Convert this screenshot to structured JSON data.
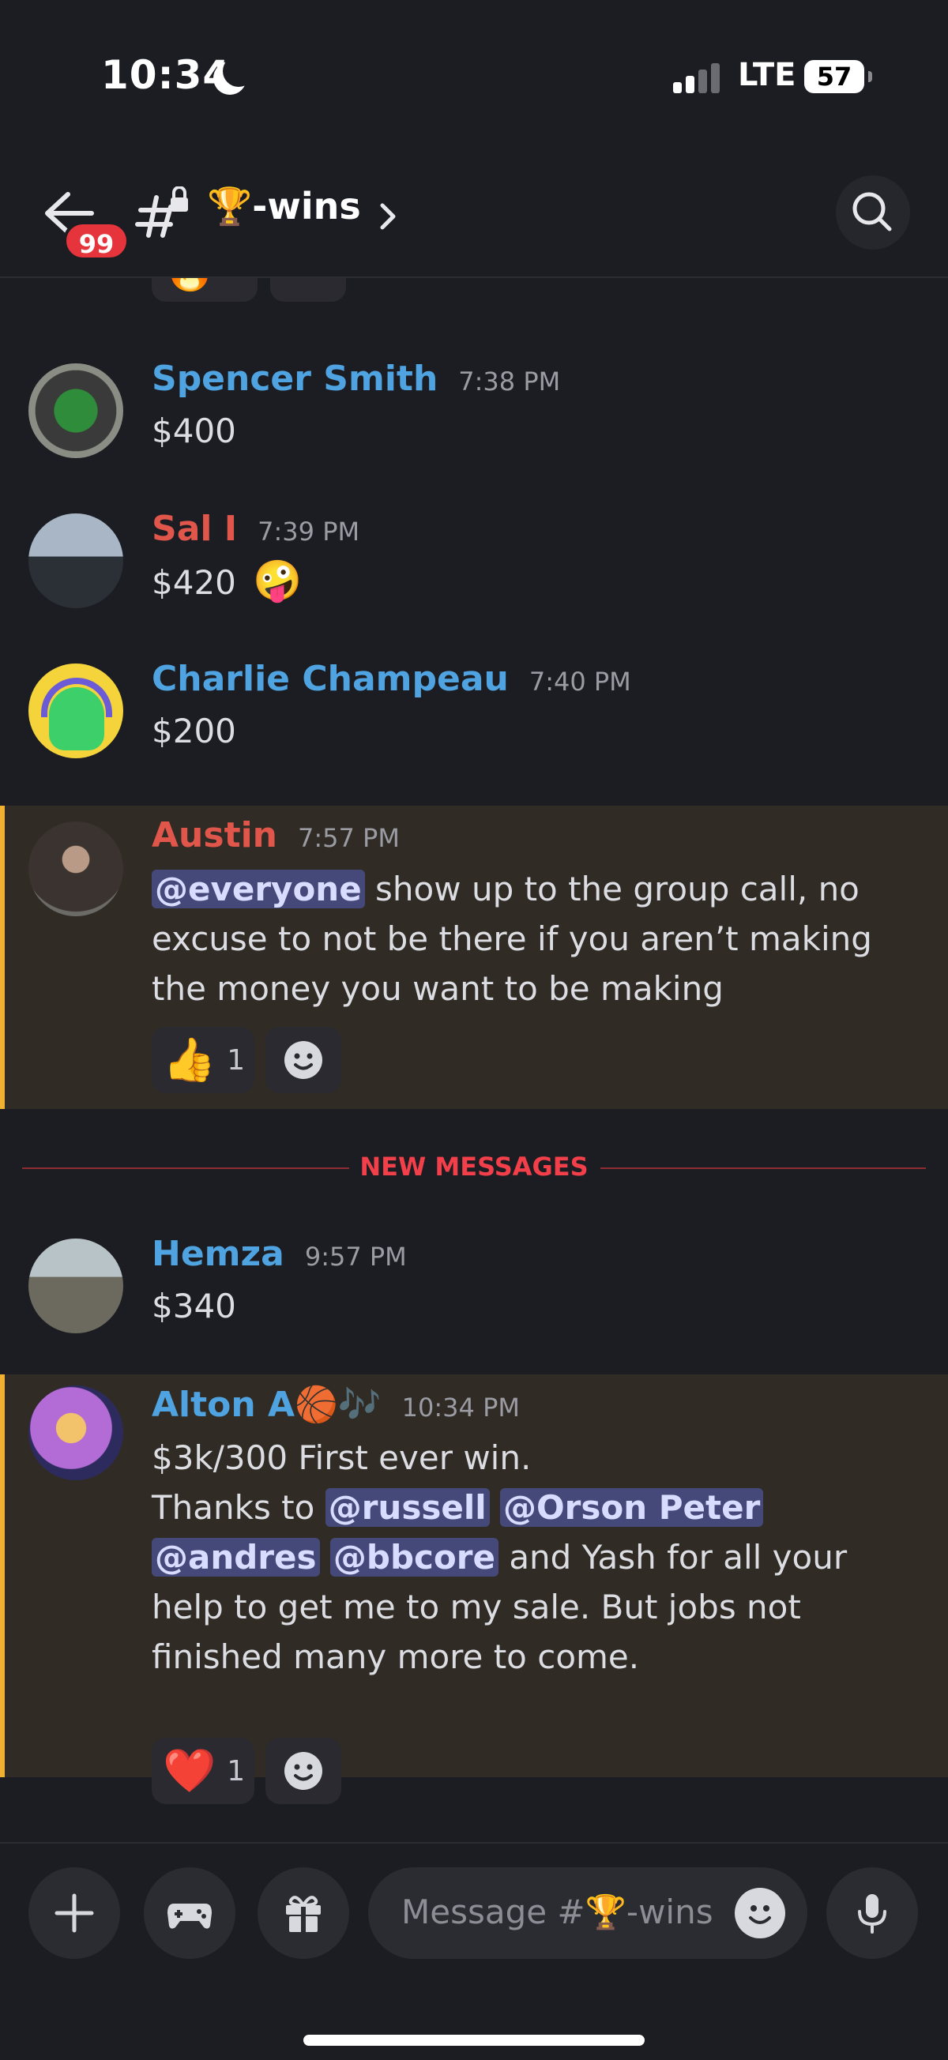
{
  "status_bar": {
    "time": "10:34",
    "network": "LTE",
    "battery": "57"
  },
  "header": {
    "unread_count": "99",
    "channel_emoji": "🏆",
    "channel_name": "🏆-wins"
  },
  "partial_top_reaction": {
    "emoji": "🔥"
  },
  "messages": [
    {
      "author": "Spencer Smith",
      "author_color": "#4fa3e0",
      "time": "7:38 PM",
      "text": "$400"
    },
    {
      "author": "Sal I",
      "author_color": "#e0564b",
      "time": "7:39 PM",
      "text": "$420",
      "emoji": "🤪"
    },
    {
      "author": "Charlie Champeau",
      "author_color": "#4fa3e0",
      "time": "7:40 PM",
      "text": "$200"
    },
    {
      "author": "Austin",
      "author_color": "#e0564b",
      "time": "7:57 PM",
      "mention": "@everyone",
      "text": "show up to the group call, no excuse to not be there if you aren’t making the money you want to be making",
      "reaction": {
        "emoji": "👍",
        "count": "1"
      }
    },
    {
      "author": "Hemza",
      "author_color": "#4fa3e0",
      "time": "9:57 PM",
      "text": "$340"
    },
    {
      "author": "Alton A🏀🎶",
      "author_color": "#4fa3e0",
      "time": "10:34 PM",
      "line1": "$3k/300 First ever win.",
      "thanks_prefix": "Thanks to",
      "mentions": [
        "@russell",
        "@Orson Peter",
        "@andres",
        "@bbcore"
      ],
      "text_after": "and Yash for all your help to get me to my sale. But jobs not finished many more to come.",
      "reaction": {
        "emoji": "❤️",
        "count": "1"
      }
    }
  ],
  "divider": {
    "label": "NEW MESSAGES"
  },
  "composer": {
    "placeholder": "Message #🏆-wins"
  },
  "colors": {
    "background": "#1c1d22",
    "highlight": "#302b24",
    "highlight_bar": "#f0b132",
    "mention_bg": "#45497a",
    "new_messages": "#f23f4a"
  }
}
